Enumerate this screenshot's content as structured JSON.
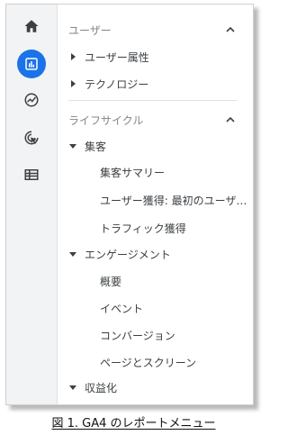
{
  "rail": {
    "items": [
      {
        "icon": "home-icon",
        "active": false
      },
      {
        "icon": "reports-icon",
        "active": true
      },
      {
        "icon": "explore-icon",
        "active": false
      },
      {
        "icon": "advertising-icon",
        "active": false
      },
      {
        "icon": "list-icon",
        "active": false
      }
    ],
    "active_color": "#1a73e8"
  },
  "sections": {
    "user": {
      "title": "ユーザー",
      "items": [
        "ユーザー属性",
        "テクノロジー"
      ]
    },
    "lifecycle": {
      "title": "ライフサイクル",
      "acquisition": {
        "label": "集客",
        "children": [
          "集客サマリー",
          "ユーザー獲得: 最初のユーザ…",
          "トラフィック獲得"
        ]
      },
      "engagement": {
        "label": "エンゲージメント",
        "children": [
          "概要",
          "イベント",
          "コンバージョン",
          "ページとスクリーン"
        ]
      },
      "monetization": {
        "label": "収益化"
      }
    }
  },
  "caption": "図 1.  GA4 のレポートメニュー"
}
